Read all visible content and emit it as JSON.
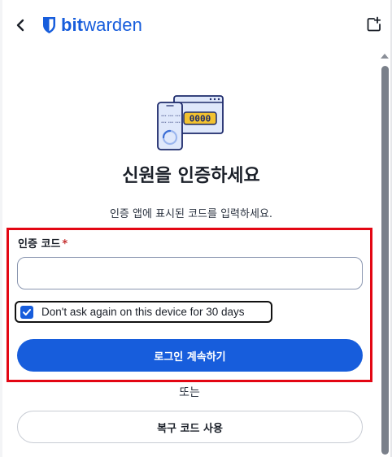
{
  "header": {
    "logo_bold": "bit",
    "logo_regular": "warden",
    "back_icon": "chevron-left-icon",
    "popout_icon": "popout-icon"
  },
  "illustration": {
    "icon": "authenticator-app-illustration",
    "code_digits": "0000",
    "phone_lines": [
      "*** *** ***",
      "*** *** ***"
    ]
  },
  "title": "신원을 인증하세요",
  "subtitle": "인증 앱에 표시된 코드를 입력하세요.",
  "form": {
    "code_label": "인증 코드",
    "required_marker": "*",
    "code_value": "",
    "remember_label": "Don't ask again on this device for 30 days",
    "remember_checked": true,
    "continue_label": "로그인 계속하기",
    "or_label": "또는",
    "recovery_label": "복구 코드 사용"
  },
  "colors": {
    "brand": "#175ddc",
    "annotation_red": "#e30613",
    "annotation_black": "#111111",
    "illustration_gold": "#f2c230",
    "illustration_navy": "#1d2a6b"
  }
}
